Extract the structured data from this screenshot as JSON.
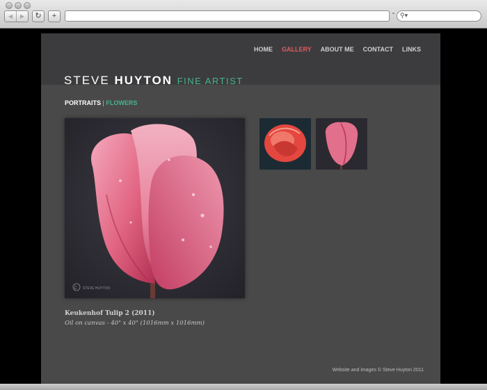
{
  "browser": {
    "back_icon": "back-arrow-icon",
    "forward_icon": "forward-arrow-icon",
    "reload_icon": "reload-icon",
    "add_icon": "plus-icon",
    "url": "",
    "search_icon": "search-icon"
  },
  "site": {
    "nav": [
      {
        "label": "HOME",
        "active": false
      },
      {
        "label": "GALLERY",
        "active": true
      },
      {
        "label": "ABOUT ME",
        "active": false
      },
      {
        "label": "CONTACT",
        "active": false
      },
      {
        "label": "LINKS",
        "active": false
      }
    ],
    "logo": {
      "first": "STEVE",
      "last": "HUYTON",
      "tagline": "FINE ARTIST"
    },
    "subnav": {
      "portraits": "PORTRAITS",
      "separator": "|",
      "flowers": "FLOWERS"
    },
    "painting": {
      "title": "Keukenhof Tulip 2 (2011)",
      "description": "Oil on canvas - 40\" x 40\" (1016mm x 1016mm)",
      "signature": "STEVE HUYTON"
    },
    "thumbnails": [
      {
        "name": "red-rose-thumbnail"
      },
      {
        "name": "pink-tulip-thumbnail"
      }
    ],
    "footer": "Website and images © Steve Huyton 2011"
  },
  "colors": {
    "accent_active": "#e05c5c",
    "accent_green": "#45b58c",
    "page_bg": "#494949"
  }
}
